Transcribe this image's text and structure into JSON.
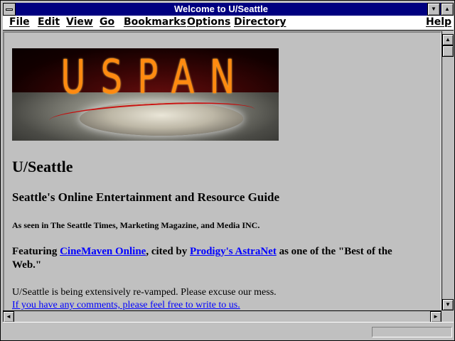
{
  "window": {
    "title": "Welcome to U/Seattle",
    "buttons": {
      "minimize": "▼",
      "maximize": "▲"
    }
  },
  "menu": [
    {
      "label": "File"
    },
    {
      "label": "Edit"
    },
    {
      "label": "View"
    },
    {
      "label": "Go"
    },
    {
      "label": "Bookmarks"
    },
    {
      "label": "Options"
    },
    {
      "label": "Directory"
    },
    {
      "label": "Help"
    }
  ],
  "page": {
    "banner_logo": "USPAN",
    "title": "U/Seattle",
    "subtitle": "Seattle's Online Entertainment and Resource Guide",
    "as_seen": "As seen in The Seattle Times, Marketing Magazine, and Media INC.",
    "feature": {
      "prefix": "Featuring ",
      "link1": "CineMaven Online",
      "middle": ", cited by ",
      "link2": "Prodigy's AstraNet",
      "suffix": " as one of the \"Best of the Web.\""
    },
    "note": "U/Seattle is being extensively re-vamped. Please excuse our mess.",
    "comment_link": "If you have any comments, please feel free to write to us."
  },
  "scrollbar": {
    "up": "▲",
    "down": "▼",
    "left": "◄",
    "right": "►"
  },
  "colors": {
    "titlebar": "#000080",
    "link": "#0000ff",
    "background": "#c0c0c0",
    "logo": "#ff8a10"
  },
  "icons": [
    "system-menu-icon",
    "minimize-icon",
    "maximize-icon",
    "scroll-up-icon",
    "scroll-down-icon",
    "scroll-left-icon",
    "scroll-right-icon"
  ]
}
